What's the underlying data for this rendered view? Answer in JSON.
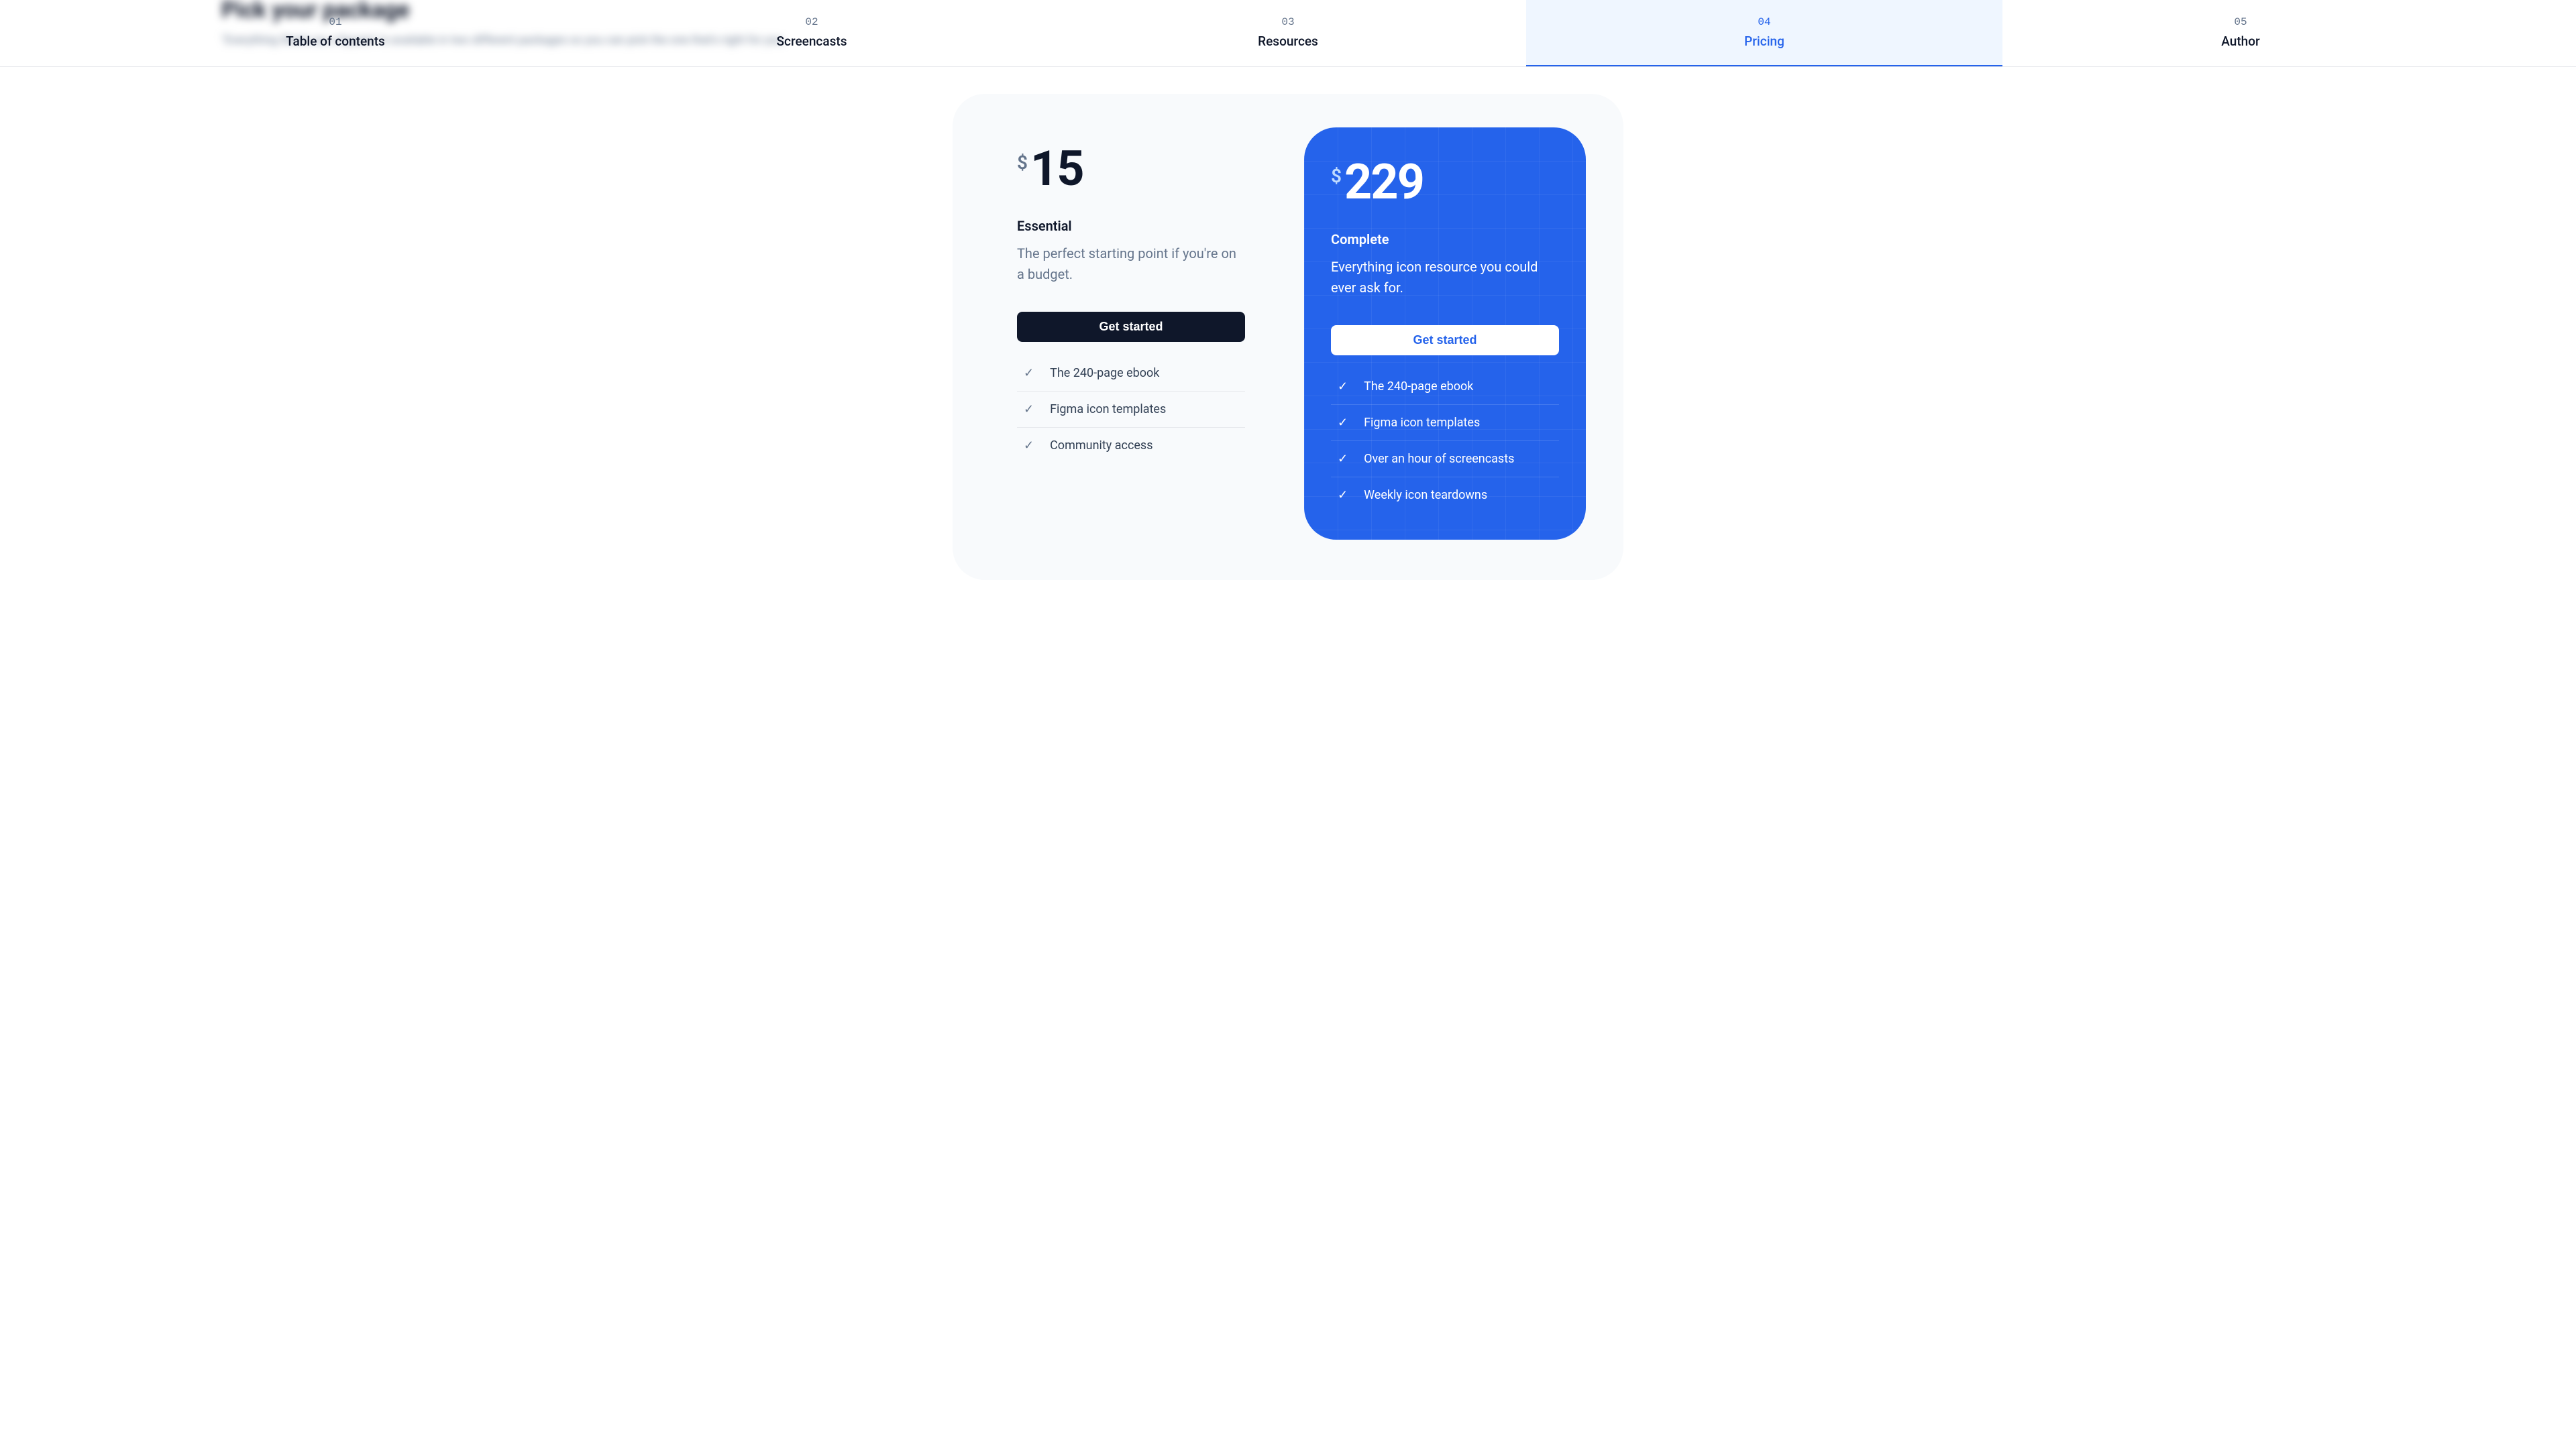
{
  "nav": {
    "items": [
      {
        "number": "01",
        "label": "Table of contents"
      },
      {
        "number": "02",
        "label": "Screencasts"
      },
      {
        "number": "03",
        "label": "Resources"
      },
      {
        "number": "04",
        "label": "Pricing"
      },
      {
        "number": "05",
        "label": "Author"
      }
    ],
    "active_index": 3
  },
  "blurred": {
    "title": "Pick your package",
    "sub": "\"Everything Starts as a Square\" is available in two different packages so you can pick the one that's right for you."
  },
  "plans": {
    "essential": {
      "currency": "$",
      "price": "15",
      "name": "Essential",
      "desc": "The perfect starting point if you're on a budget.",
      "cta": "Get started",
      "features": [
        "The 240-page ebook",
        "Figma icon templates",
        "Community access"
      ]
    },
    "complete": {
      "currency": "$",
      "price": "229",
      "name": "Complete",
      "desc": "Everything icon resource you could ever ask for.",
      "cta": "Get started",
      "features": [
        "The 240-page ebook",
        "Figma icon templates",
        "Over an hour of screencasts",
        "Weekly icon teardowns"
      ]
    }
  }
}
